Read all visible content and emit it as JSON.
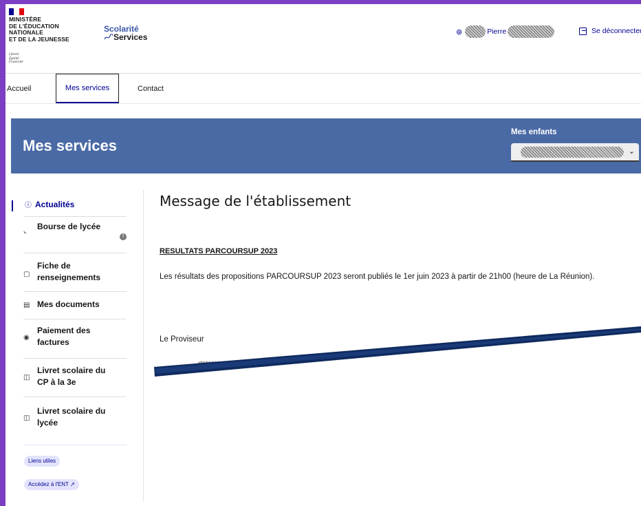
{
  "header": {
    "ministry_lines": [
      "MINISTÈRE",
      "DE L'ÉDUCATION",
      "NATIONALE",
      "ET DE LA JEUNESSE"
    ],
    "devise": [
      "Liberté",
      "Égalité",
      "Fraternité"
    ],
    "brand_top": "Scolarité",
    "brand_bottom": "Services",
    "user_name": "Pierre",
    "logout_label": "Se déconnecter"
  },
  "nav": {
    "items": [
      {
        "label": "Accueil"
      },
      {
        "label": "Mes services",
        "active": true
      },
      {
        "label": "Contact"
      }
    ]
  },
  "banner": {
    "title": "Mes services",
    "children_label": "Mes enfants"
  },
  "sidebar": {
    "items": [
      {
        "label": "Actualités",
        "icon": "info-icon",
        "active": true
      },
      {
        "label": "Bourse de lycée",
        "icon": "people-icon",
        "badge": "!"
      },
      {
        "label": "Fiche de renseignements",
        "icon": "file-icon"
      },
      {
        "label": "Mes documents",
        "icon": "documents-icon"
      },
      {
        "label": "Paiement des factures",
        "icon": "coin-icon"
      },
      {
        "label": "Livret scolaire du CP à la 3e",
        "icon": "book-icon"
      },
      {
        "label": "Livret scolaire du lycée",
        "icon": "book-icon"
      }
    ],
    "tags": [
      "Liens utiles",
      "Accédez à l'ENT ↗"
    ]
  },
  "main": {
    "title": "Message de l'établissement",
    "subject": "RESULTATS PARCOURSUP 2023",
    "body": "Les résultats des propositions PARCOURSUP 2023 seront publiés le 1er juin 2023 à partir de 21h00 (heure de La Réunion).",
    "signature_role": "Le Proviseur"
  },
  "colors": {
    "frame": "#7b3fc4",
    "banner": "#4a6aa5",
    "accent": "#000091",
    "strike_line": "#1a3a78"
  }
}
